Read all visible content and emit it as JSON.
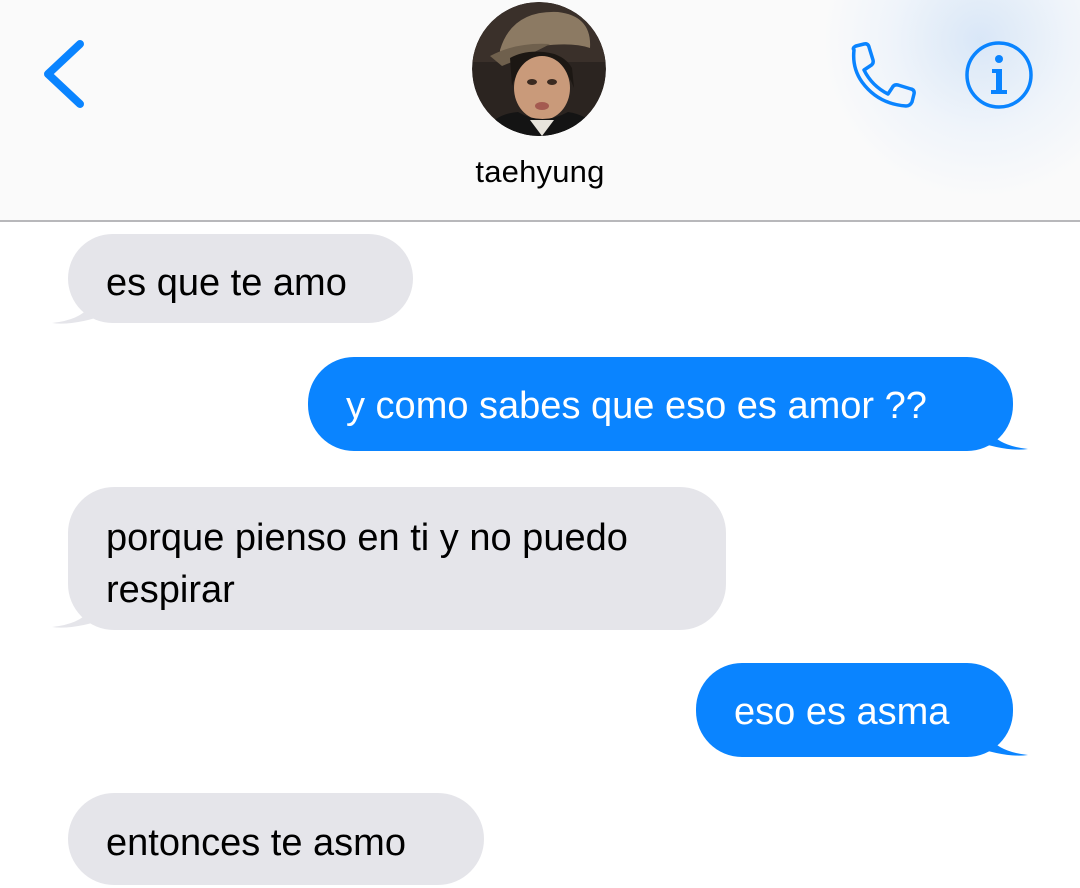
{
  "header": {
    "contact_name": "taehyung",
    "back_icon": "chevron-left-icon",
    "call_icon": "phone-icon",
    "info_icon": "info-icon",
    "accent_color": "#0a84ff"
  },
  "messages": [
    {
      "direction": "received",
      "lines": [
        "es que te amo"
      ]
    },
    {
      "direction": "sent",
      "lines": [
        "y como sabes que eso es amor ??"
      ]
    },
    {
      "direction": "received",
      "lines": [
        "porque pienso en ti y no puedo",
        "respirar"
      ]
    },
    {
      "direction": "sent",
      "lines": [
        "eso es asma"
      ]
    },
    {
      "direction": "received",
      "lines": [
        "entonces te asmo"
      ]
    }
  ],
  "colors": {
    "sent_bubble": "#0a84ff",
    "received_bubble": "#e5e5ea",
    "header_bg": "#fafafa"
  }
}
